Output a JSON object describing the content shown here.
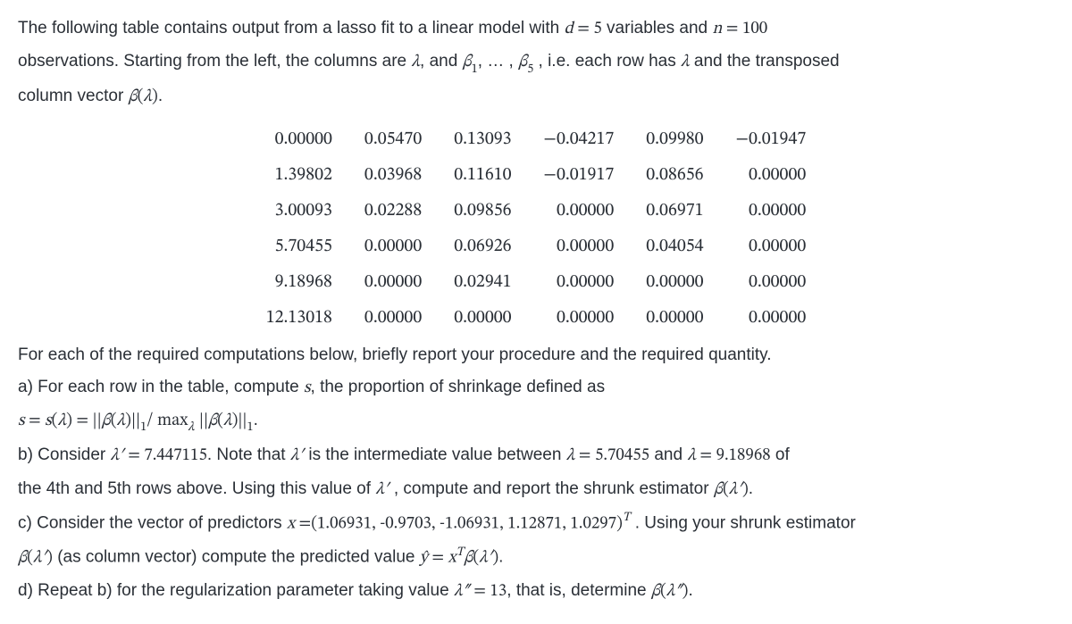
{
  "intro": {
    "t1a": "The following table contains output from a lasso fit to a linear model with ",
    "d": "d",
    "eq1": " = ",
    "d_val": "5",
    "t1b": " variables and ",
    "n": "n",
    "eq2": " = ",
    "n_val": "100",
    "t2a": "observations. Starting from the left, the columns are ",
    "lam": "λ",
    "t2b": ", and ",
    "b1": "β",
    "b1sub": "1",
    "t2c": ", … , ",
    "b5": "β",
    "b5sub": "5",
    "t2d": " , i.e. each row has ",
    "lam2": "λ",
    "t2e": " and the transposed",
    "t3a": "column vector ",
    "bsym": "β",
    "lp": "(",
    "lam3": "λ",
    "rp": ")",
    "dot": "."
  },
  "table": [
    [
      "0.00000",
      "0.05470",
      "0.13093",
      "−0.04217",
      "0.09980",
      "−0.01947"
    ],
    [
      "1.39802",
      "0.03968",
      "0.11610",
      "−0.01917",
      "0.08656",
      "0.00000"
    ],
    [
      "3.00093",
      "0.02288",
      "0.09856",
      "0.00000",
      "0.06971",
      "0.00000"
    ],
    [
      "5.70455",
      "0.00000",
      "0.06926",
      "0.00000",
      "0.04054",
      "0.00000"
    ],
    [
      "9.18968",
      "0.00000",
      "0.02941",
      "0.00000",
      "0.00000",
      "0.00000"
    ],
    [
      "12.13018",
      "0.00000",
      "0.00000",
      "0.00000",
      "0.00000",
      "0.00000"
    ]
  ],
  "qintro": "For each of the required computations below, briefly report your procedure and the required quantity.",
  "a": {
    "line1a": "a) For each row in the table, compute ",
    "s": "s",
    "line1b": ", the proportion of shrinkage defined as",
    "line2a_s": "s",
    "eq": " = ",
    "sfun": "s",
    "lp": "(",
    "lam": "λ",
    "rp": ")",
    "eq2": " = ",
    "norm_open": "||",
    "beta": "β",
    "lp2": "(",
    "lam2": "λ",
    "rp2": ")",
    "norm_close": "||",
    "sub1": "1",
    "slash": "/ ",
    "max": "max",
    "maxsub": "λ",
    "sp": " ",
    "norm_open2": "||",
    "beta2": "β",
    "lp3": "(",
    "lam3": "λ",
    "rp3": ")",
    "norm_close2": "||",
    "sub1b": "1",
    "dot": "."
  },
  "b": {
    "t1": "b) Consider ",
    "lamp": "λ′",
    "eq": " = ",
    "val": "7.447115",
    "t2": ". Note that ",
    "lamp2": "λ′",
    "t3": " is the intermediate value between ",
    "lam": "λ",
    "eq2": " = ",
    "v4": "5.70455",
    "and": " and ",
    "lam2": "λ",
    "eq3": " = ",
    "v5": "9.18968",
    "of": " of",
    "t4": "the 4th and 5th rows above. Using this value of ",
    "lamp3": "λ′",
    "t5": " , compute and report the shrunk estimator ",
    "beta": "β",
    "lp": "(",
    "lamp4": "λ′",
    "rp": ")",
    "dot": "."
  },
  "c": {
    "t1": "c) Consider the vector of predictors ",
    "x": "x",
    "eq": " =",
    "vec": "(1.06931, -0.9703, -1.06931, 1.12871, 1.0297)",
    "T": "T",
    "t2": " . Using your shrunk estimator",
    "beta": "β",
    "lp": "(",
    "lamp": "λ′",
    "rp": ")",
    "t3": " (as column vector) compute the predicted value ",
    "yhat": "ŷ",
    "eq2": " = ",
    "x2": "x",
    "T2": "T",
    "beta2": "β",
    "lp2": "(",
    "lamp2": "λ′",
    "rp2": ")",
    "dot": "."
  },
  "d": {
    "t1": "d) Repeat b) for the regularization parameter taking value ",
    "lampp": "λ″",
    "eq": " = ",
    "val": " 13",
    "t2": ", that is, determine ",
    "beta": "β",
    "lp": "(",
    "lampp2": "λ″",
    "rp": ")",
    "dot": "."
  }
}
